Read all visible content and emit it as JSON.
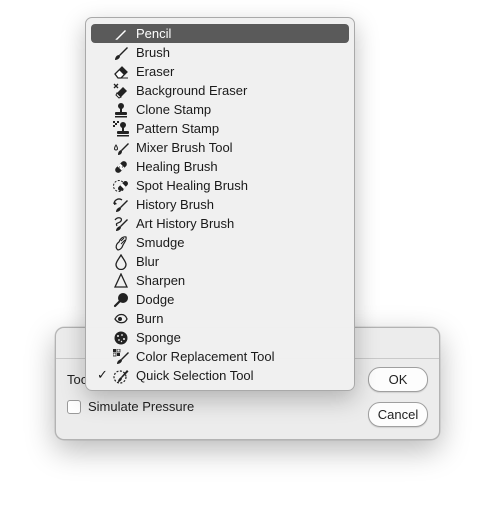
{
  "dialog": {
    "tool_label": "Too",
    "simulate_pressure_label": "Simulate Pressure",
    "ok_label": "OK",
    "cancel_label": "Cancel"
  },
  "menu": {
    "items": [
      {
        "label": "Pencil",
        "icon": "pencil-icon",
        "selected": true
      },
      {
        "label": "Brush",
        "icon": "brush-icon"
      },
      {
        "label": "Eraser",
        "icon": "eraser-icon"
      },
      {
        "label": "Background Eraser",
        "icon": "background-eraser-icon"
      },
      {
        "label": "Clone Stamp",
        "icon": "clone-stamp-icon"
      },
      {
        "label": "Pattern Stamp",
        "icon": "pattern-stamp-icon"
      },
      {
        "label": "Mixer Brush Tool",
        "icon": "mixer-brush-icon"
      },
      {
        "label": "Healing Brush",
        "icon": "healing-brush-icon"
      },
      {
        "label": "Spot Healing Brush",
        "icon": "spot-healing-brush-icon"
      },
      {
        "label": "History Brush",
        "icon": "history-brush-icon"
      },
      {
        "label": "Art History Brush",
        "icon": "art-history-brush-icon"
      },
      {
        "label": "Smudge",
        "icon": "smudge-icon"
      },
      {
        "label": "Blur",
        "icon": "blur-icon"
      },
      {
        "label": "Sharpen",
        "icon": "sharpen-icon"
      },
      {
        "label": "Dodge",
        "icon": "dodge-icon"
      },
      {
        "label": "Burn",
        "icon": "burn-icon"
      },
      {
        "label": "Sponge",
        "icon": "sponge-icon"
      },
      {
        "label": "Color Replacement Tool",
        "icon": "color-replacement-icon"
      },
      {
        "label": "Quick Selection Tool",
        "icon": "quick-selection-icon",
        "checked": true,
        "check_mark": "✓"
      }
    ]
  }
}
